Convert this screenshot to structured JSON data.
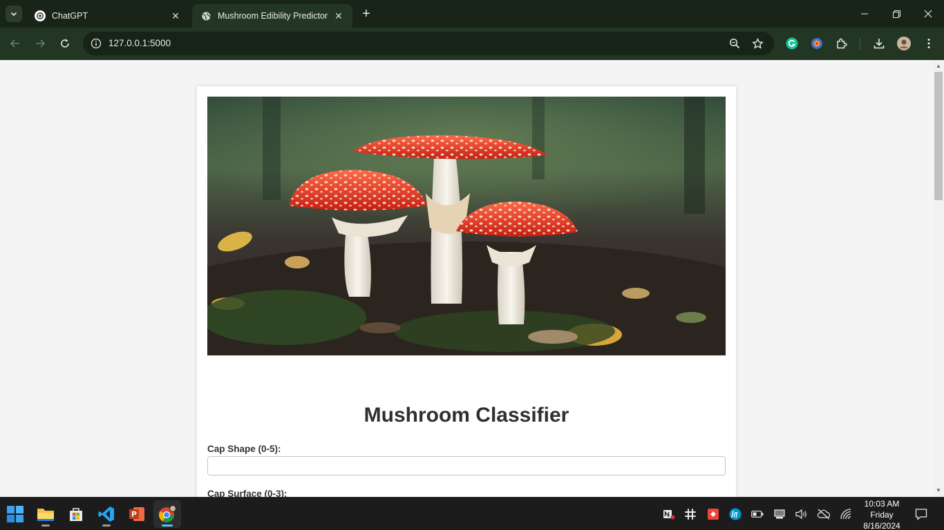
{
  "browser": {
    "tabs": [
      {
        "title": "ChatGPT",
        "icon": "chatgpt-icon",
        "active": false
      },
      {
        "title": "Mushroom Edibility Predictor",
        "icon": "globe-icon",
        "active": true
      }
    ],
    "url": "127.0.0.1:5000",
    "colors": {
      "frame": "#172417",
      "toolbar": "#233523",
      "omnibox": "#162316"
    }
  },
  "page": {
    "hero_image": "fly-agaric-mushrooms-photo",
    "title": "Mushroom Classifier",
    "fields": [
      {
        "label": "Cap Shape (0-5):",
        "value": ""
      },
      {
        "label": "Cap Surface (0-3):",
        "value": ""
      }
    ]
  },
  "taskbar": {
    "apps": [
      "start-icon",
      "file-explorer-icon",
      "microsoft-store-icon",
      "vscode-icon",
      "powerpoint-icon",
      "chrome-icon"
    ],
    "clock": {
      "time": "10:03 AM",
      "day": "Friday",
      "date": "8/16/2024"
    }
  }
}
